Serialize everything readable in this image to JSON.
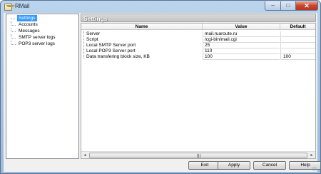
{
  "window": {
    "title": "RMail",
    "minimize_glyph": "–",
    "maximize_glyph": "□",
    "close_glyph": "✕"
  },
  "tree": {
    "items": [
      {
        "label": "Settings",
        "selected": true
      },
      {
        "label": "Accounts",
        "selected": false
      },
      {
        "label": "Messages",
        "selected": false
      },
      {
        "label": "SMTP server logs",
        "selected": false
      },
      {
        "label": "POP3 server logs",
        "selected": false
      }
    ]
  },
  "panel": {
    "title": "Settings"
  },
  "grid": {
    "columns": [
      "Name",
      "Value",
      "Default"
    ],
    "rows": [
      {
        "name": "Server",
        "value": "mail.ruaroute.ru",
        "default": ""
      },
      {
        "name": "Script",
        "value": "/cgi-bin/mail.cgi",
        "default": ""
      },
      {
        "name": "Local SMTP Server port",
        "value": "25",
        "default": ""
      },
      {
        "name": "Local POP3 Server port",
        "value": "110",
        "default": ""
      },
      {
        "name": "Data transfering block size, KB",
        "value": "100",
        "default": "100"
      }
    ]
  },
  "scrollbar": {
    "left_glyph": "◂",
    "right_glyph": "▸"
  },
  "buttons": {
    "exit": "Exit",
    "apply": "Apply",
    "cancel": "Cancel",
    "help": "Help"
  }
}
